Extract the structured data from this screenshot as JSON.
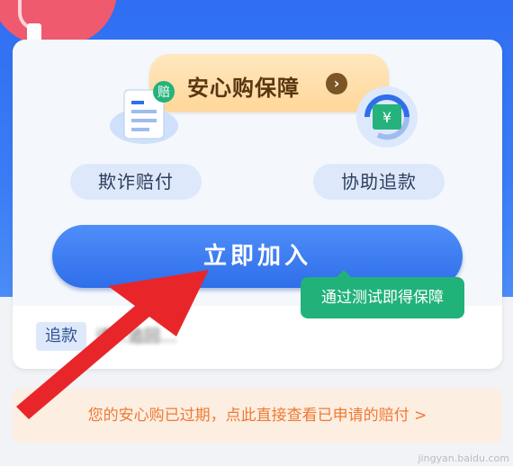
{
  "banner": {
    "title": "安心购保障",
    "chevron": "›"
  },
  "features": [
    {
      "label": "欺诈赔付",
      "icon": "document-compensation-icon",
      "badge": "赔"
    },
    {
      "label": "协助追款",
      "icon": "money-refresh-icon",
      "badge": "¥"
    }
  ],
  "join_button": {
    "label": "立即加入"
  },
  "tooltip": {
    "text": "通过测试即得保障"
  },
  "row": {
    "chip": "追款",
    "blurred_text": "请…追回…"
  },
  "notice": {
    "text": "您的安心购已过期，点此直接查看已申请的赔付 >"
  },
  "colors": {
    "primary": "#2f6eea",
    "tooltip": "#21b27a",
    "notice_text": "#ee7a33",
    "arrow": "#e8262a"
  },
  "watermark": "jingyan.baidu.com"
}
